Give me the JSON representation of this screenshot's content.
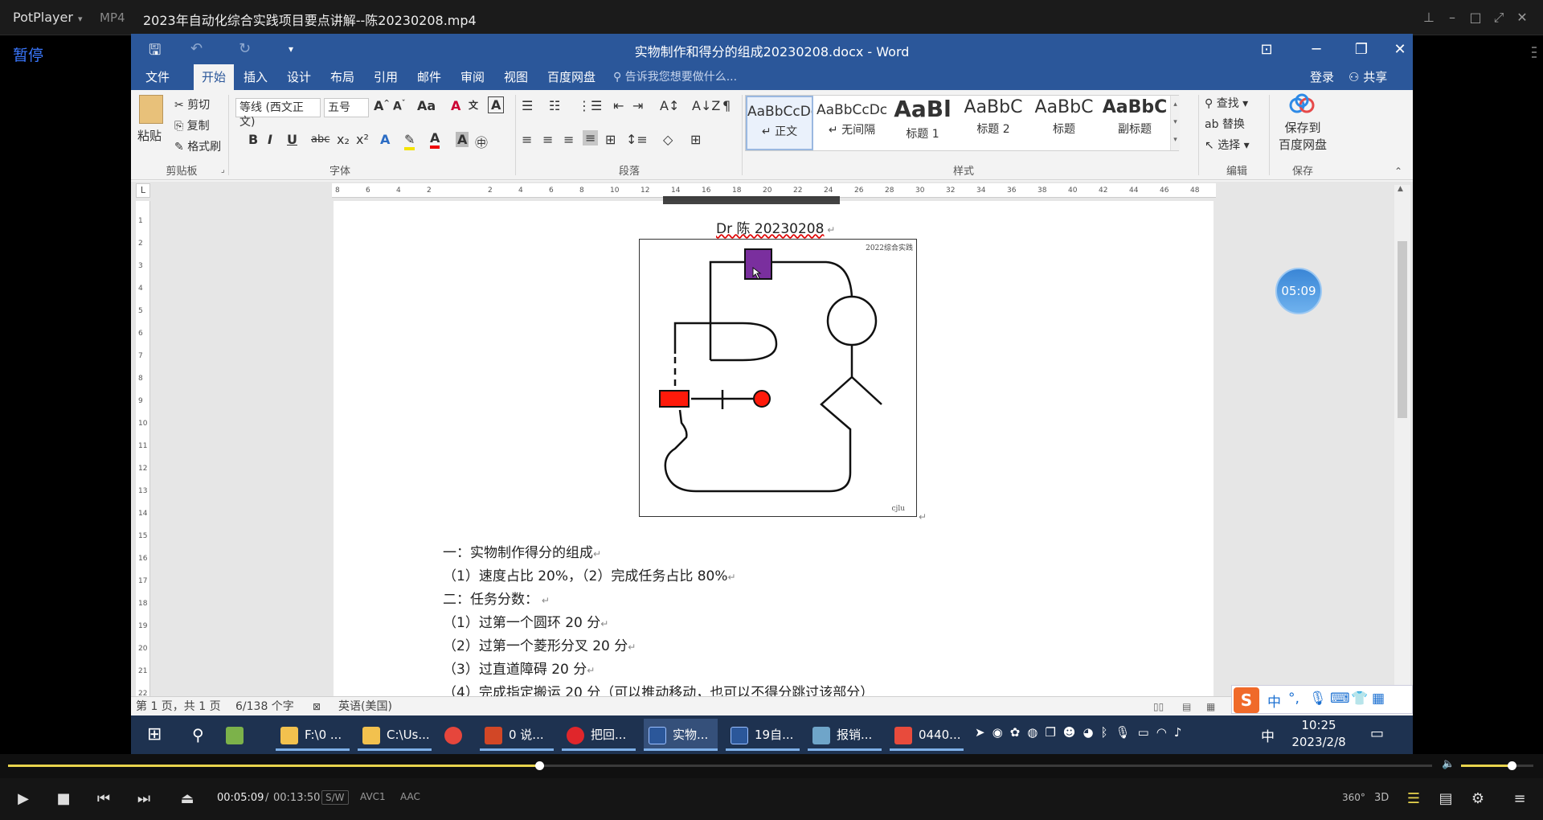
{
  "player": {
    "brand": "PotPlayer",
    "format": "MP4",
    "file_title": "2023年自动化综合实践项目要点讲解--陈20230208.mp4",
    "status": "暂停",
    "time_current": "00:05:09",
    "time_sep": "/",
    "time_total": "00:13:50",
    "badge_sw": "S/W",
    "badge_video": "AVC1",
    "badge_audio": "AAC",
    "progress": 0.373,
    "volume": 0.7,
    "btn_360": "360°",
    "btn_3d": "3D"
  },
  "word": {
    "window_title": "实物制作和得分的组成20230208.docx - Word",
    "tabs": [
      "文件",
      "开始",
      "插入",
      "设计",
      "布局",
      "引用",
      "邮件",
      "审阅",
      "视图",
      "百度网盘"
    ],
    "active_tab": "开始",
    "tell_me": "告诉我您想要做什么...",
    "login": "登录",
    "share": "共享",
    "clipboard": {
      "paste": "粘贴",
      "cut": "剪切",
      "copy": "复制",
      "format_painter": "格式刷",
      "label": "剪贴板"
    },
    "font": {
      "name": "等线 (西文正文)",
      "size": "五号",
      "label": "字体"
    },
    "paragraph": {
      "label": "段落"
    },
    "styles": {
      "label": "样式",
      "items": [
        {
          "preview": "AaBbCcDc",
          "name": "↵ 正文"
        },
        {
          "preview": "AaBbCcDc",
          "name": "↵ 无间隔"
        },
        {
          "preview": "AaBl",
          "name": "标题 1"
        },
        {
          "preview": "AaBbC",
          "name": "标题 2"
        },
        {
          "preview": "AaBbC",
          "name": "标题"
        },
        {
          "preview": "AaBbC",
          "name": "副标题"
        }
      ]
    },
    "editing": {
      "find": "查找",
      "replace": "替换",
      "select": "选择",
      "label": "编辑"
    },
    "save": {
      "save_to": "保存到",
      "baidu": "百度网盘",
      "label": "保存"
    },
    "ruler_numbers": [
      "8",
      "6",
      "4",
      "2",
      "",
      "2",
      "4",
      "6",
      "8",
      "10",
      "12",
      "14",
      "16",
      "18",
      "20",
      "22",
      "24",
      "26",
      "28",
      "30",
      "32",
      "34",
      "36",
      "38",
      "40",
      "42",
      "44",
      "46",
      "48"
    ],
    "vruler_numbers": [
      "1",
      "2",
      "3",
      "4",
      "5",
      "6",
      "7",
      "8",
      "9",
      "10",
      "11",
      "12",
      "13",
      "14",
      "15",
      "16",
      "17",
      "18",
      "19",
      "20",
      "21",
      "22"
    ],
    "document": {
      "author_line": "Dr 陈 20230208",
      "figure_corner": "2022综合实践",
      "figure_mark": "cjlu",
      "lines": [
        "一：实物制作得分的组成",
        "（1）速度占比 20%，（2）完成任务占比 80%",
        "二：任务分数：",
        "（1）过第一个圆环 20 分",
        "（2）过第一个菱形分叉 20 分",
        "（3）过直道障碍 20 分",
        "（4）完成指定搬运 20 分（可以推动移动，也可以不得分跳过该部分）"
      ]
    },
    "statusbar": {
      "page": "第 1 页，共 1 页",
      "words": "6/138 个字",
      "language": "英语(美国)"
    },
    "timer_badge": "05:09"
  },
  "taskbar": {
    "items": [
      {
        "label": "F:\\0 ...",
        "color": "#f2c14e"
      },
      {
        "label": "C:\\Us...",
        "color": "#f2c14e"
      },
      {
        "label": "",
        "color": "#e6463c"
      },
      {
        "label": "0 说...",
        "color": "#d24726"
      },
      {
        "label": "把回...",
        "color": "#e0262b"
      },
      {
        "label": "实物...",
        "color": "#2b579a"
      },
      {
        "label": "19自...",
        "color": "#2b579a"
      },
      {
        "label": "报销...",
        "color": "#6fa5c9"
      },
      {
        "label": "0440...",
        "color": "#e84b3c"
      }
    ],
    "ime": "中",
    "time": "10:25",
    "date": "2023/2/8"
  }
}
